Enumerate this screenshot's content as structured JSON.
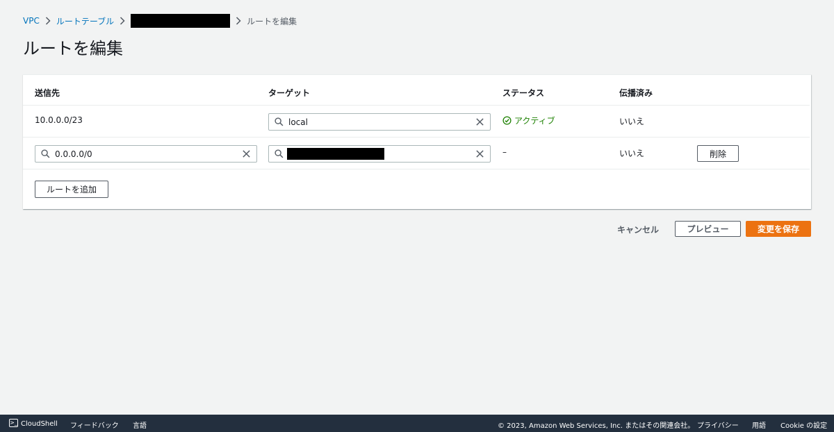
{
  "breadcrumb": {
    "items": [
      "VPC",
      "ルートテーブル"
    ],
    "current": "ルートを編集"
  },
  "page": {
    "title": "ルートを編集"
  },
  "table": {
    "headers": {
      "destination": "送信先",
      "target": "ターゲット",
      "status": "ステータス",
      "propagated": "伝播済み"
    },
    "rows": [
      {
        "destination": "10.0.0.0/23",
        "target": "local",
        "status": "アクティブ",
        "propagated": "いいえ"
      },
      {
        "destination": "0.0.0.0/0",
        "target": "",
        "status": "–",
        "propagated": "いいえ",
        "remove_label": "削除"
      }
    ]
  },
  "add_route_label": "ルートを追加",
  "actions": {
    "cancel": "キャンセル",
    "preview": "プレビュー",
    "save": "変更を保存"
  },
  "footer": {
    "cloudshell": "CloudShell",
    "feedback": "フィードバック",
    "language": "言語",
    "copyright": "© 2023, Amazon Web Services, Inc. またはその関連会社。",
    "privacy": "プライバシー",
    "terms": "用語",
    "cookie": "Cookie の設定"
  },
  "colors": {
    "primary": "#ec7211",
    "link": "#0073bb",
    "success": "#1d8102",
    "footer_bg": "#232f3e"
  }
}
